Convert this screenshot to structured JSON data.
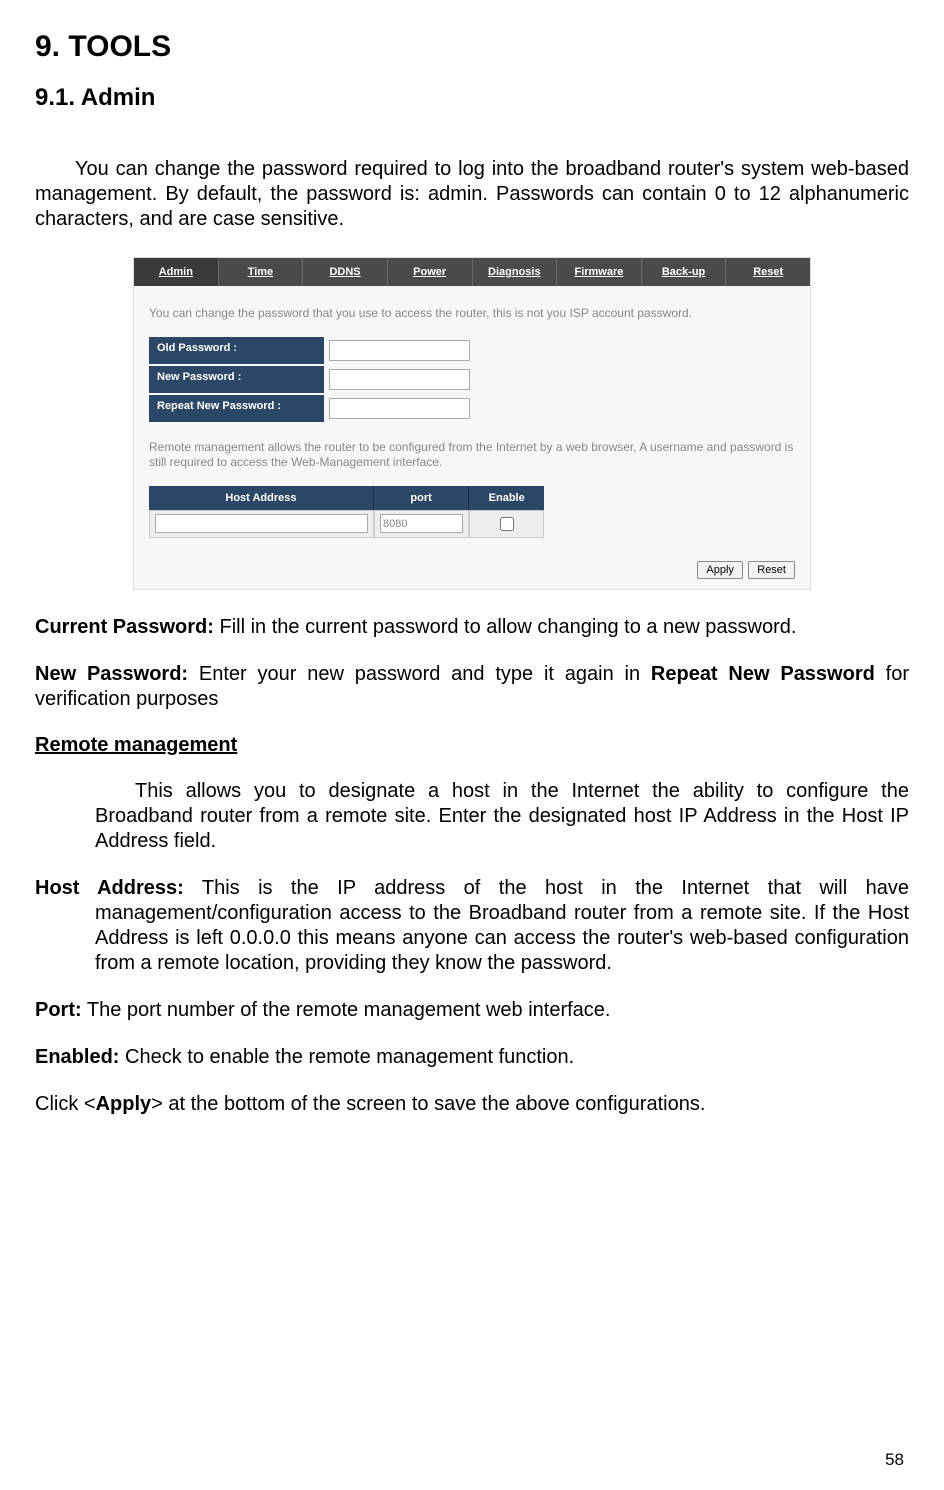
{
  "headings": {
    "h1": "9. TOOLS",
    "h2": "9.1. Admin"
  },
  "intro": "You can change the password required to log into the broadband router's system web-based management. By default, the password is: admin. Passwords can contain 0 to 12 alphanumeric characters, and are case sensitive.",
  "screenshot": {
    "tabs": [
      "Admin",
      "Time",
      "DDNS",
      "Power",
      "Diagnosis",
      "Firmware",
      "Back-up",
      "Reset"
    ],
    "help1": "You can change the password that you use to access the router, this is not you ISP account password.",
    "labels": {
      "old": "Old Password :",
      "new": "New Password :",
      "repeat": "Repeat New Password :"
    },
    "help2": "Remote management allows the router to be configured from the Internet by a web browser, A username and password is still required to access the Web-Management interface.",
    "table": {
      "head": [
        "Host Address",
        "port",
        "Enable"
      ],
      "port_value": "8080"
    },
    "buttons": {
      "apply": "Apply",
      "reset": "Reset"
    }
  },
  "definitions": {
    "current_pwd_label": "Current Password:",
    "current_pwd_text": " Fill in the current password to allow changing to a new password.",
    "new_pwd_label": "New Password:",
    "new_pwd_text1": " Enter your new password and type it again in ",
    "new_pwd_bold": "Repeat New Password",
    "new_pwd_text2": " for verification purposes",
    "remote_heading": "Remote management",
    "remote_body": "This allows you to designate a host in the Internet the ability to configure the Broadband router from a remote site. Enter the designated host IP Address in the Host IP Address field.",
    "host_label": "Host Address:",
    "host_text": " This is the IP address of the host in the Internet that will have management/configuration access to the Broadband router from a remote site. If the Host Address is left 0.0.0.0 this means anyone can access the router's web-based configuration from a remote location, providing they know the password.",
    "port_label": "Port:",
    "port_text": " The port number of the remote management web interface.",
    "enabled_label": "Enabled:",
    "enabled_text": " Check to enable the remote management function.",
    "click_prefix": "Click <",
    "click_bold": "Apply",
    "click_suffix": "> at the bottom of the screen to save the above configurations."
  },
  "page_number": "58"
}
